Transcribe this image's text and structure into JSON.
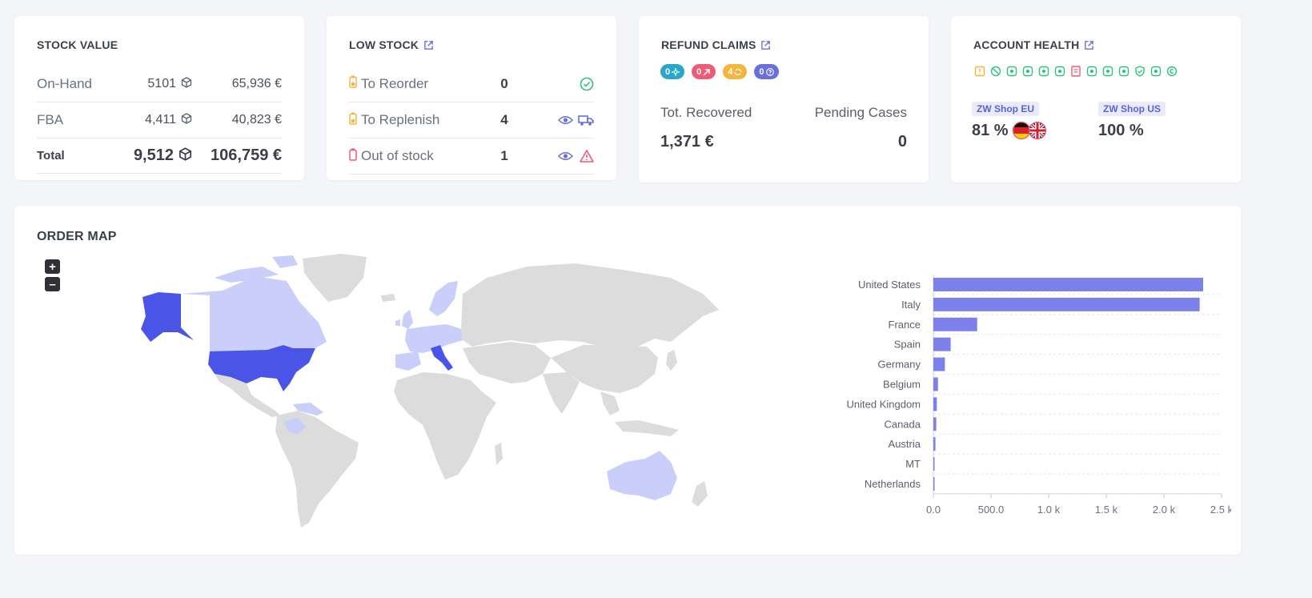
{
  "stock_value": {
    "title": "STOCK VALUE",
    "rows": [
      {
        "label": "On-Hand",
        "qty": "5101",
        "value": "65,936 €"
      },
      {
        "label": "FBA",
        "qty": "4,411",
        "value": "40,823 €"
      },
      {
        "label": "Total",
        "qty": "9,512",
        "value": "106,759 €"
      }
    ]
  },
  "low_stock": {
    "title": "LOW STOCK",
    "rows": [
      {
        "label": "To Reorder",
        "count": "0"
      },
      {
        "label": "To Replenish",
        "count": "4"
      },
      {
        "label": "Out of stock",
        "count": "1"
      }
    ]
  },
  "refund_claims": {
    "title": "REFUND CLAIMS",
    "pills": [
      {
        "count": "0",
        "color": "#2aa6c7",
        "icon": "sun-icon"
      },
      {
        "count": "0",
        "color": "#ef5a77",
        "icon": "arrow-up-right-icon"
      },
      {
        "count": "4",
        "color": "#f5b53f",
        "icon": "rotate-icon"
      },
      {
        "count": "0",
        "color": "#6a6fe0",
        "icon": "question-icon"
      }
    ],
    "recovered_label": "Tot. Recovered",
    "recovered_value": "1,371 €",
    "pending_label": "Pending Cases",
    "pending_value": "0"
  },
  "account_health": {
    "title": "ACCOUNT HEALTH",
    "icon_colors": [
      "#f5b53f",
      "#2ec27e",
      "#2ec27e",
      "#2ec27e",
      "#2ec27e",
      "#2ec27e",
      "#ef5a77",
      "#2ec27e",
      "#2ec27e",
      "#2ec27e",
      "#2ec27e",
      "#2ec27e",
      "#2ec27e"
    ],
    "shops": [
      {
        "name": "ZW Shop EU",
        "value": "81 %"
      },
      {
        "name": "ZW Shop US",
        "value": "100 %"
      }
    ]
  },
  "order_map": {
    "title": "ORDER MAP",
    "zoom_in": "+",
    "zoom_out": "–",
    "colors": {
      "high": "#4a55e8",
      "low": "#c9cff9",
      "none": "#dcdcdc",
      "bar": "#7b80ea"
    }
  },
  "chart_data": {
    "type": "bar",
    "orientation": "horizontal",
    "categories": [
      "United States",
      "Italy",
      "France",
      "Spain",
      "Germany",
      "Belgium",
      "United Kingdom",
      "Canada",
      "Austria",
      "MT",
      "Netherlands"
    ],
    "values": [
      2340,
      2310,
      380,
      150,
      100,
      40,
      30,
      25,
      18,
      10,
      8
    ],
    "xlim": [
      0,
      2500
    ],
    "xticks": [
      "0.0",
      "500.0",
      "1.0 k",
      "1.5 k",
      "2.0 k",
      "2.5 k"
    ],
    "grid": true
  }
}
